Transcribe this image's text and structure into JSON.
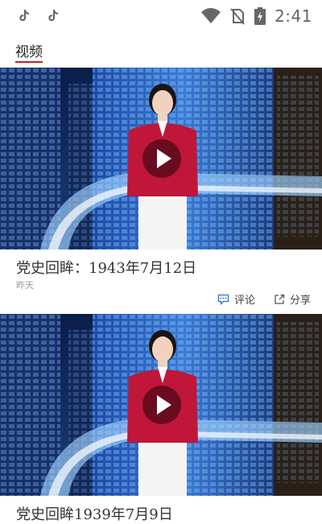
{
  "status_bar": {
    "time": "2:41",
    "left_icons": [
      "tiktok-icon",
      "tiktok-icon"
    ],
    "right_icons": [
      "wifi-icon",
      "no-sim-icon",
      "battery-charging-icon"
    ]
  },
  "header": {
    "tab_label": "视频",
    "accent_color": "#b3262a"
  },
  "videos": [
    {
      "title": "党史回眸：1943年7月12日",
      "date": "昨天",
      "comment_label": "评论",
      "share_label": "分享"
    },
    {
      "title": "党史回眸1939年7月9日"
    }
  ]
}
